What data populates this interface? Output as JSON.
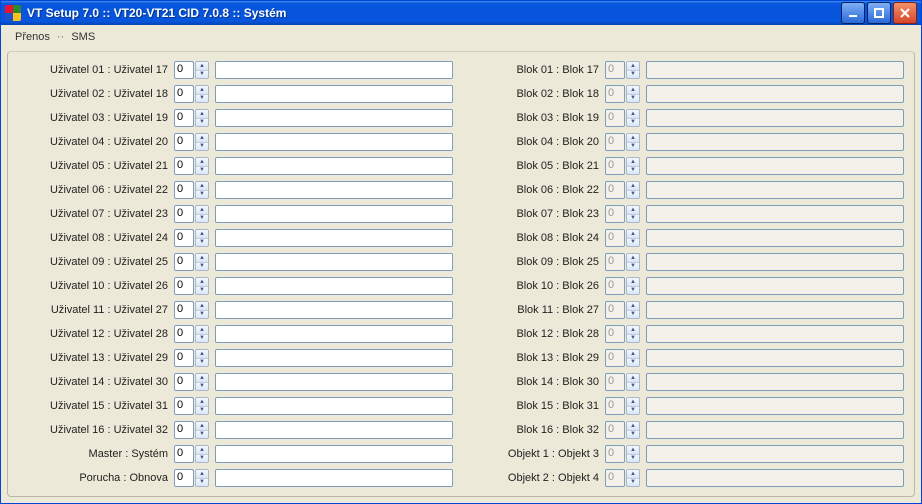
{
  "window": {
    "title": "VT Setup 7.0 :: VT20-VT21 CID 7.0.8 :: Systém"
  },
  "menubar": {
    "items": [
      "Přenos",
      "SMS"
    ],
    "separator": "··"
  },
  "columns": {
    "left": {
      "rows": [
        {
          "label": "Uživatel 01 : Uživatel 17",
          "num": "0",
          "enabled": true,
          "text": ""
        },
        {
          "label": "Uživatel 02 : Uživatel 18",
          "num": "0",
          "enabled": true,
          "text": ""
        },
        {
          "label": "Uživatel 03 : Uživatel 19",
          "num": "0",
          "enabled": true,
          "text": ""
        },
        {
          "label": "Uživatel 04 : Uživatel 20",
          "num": "0",
          "enabled": true,
          "text": ""
        },
        {
          "label": "Uživatel 05 : Uživatel 21",
          "num": "0",
          "enabled": true,
          "text": ""
        },
        {
          "label": "Uživatel 06 : Uživatel 22",
          "num": "0",
          "enabled": true,
          "text": ""
        },
        {
          "label": "Uživatel 07 : Uživatel 23",
          "num": "0",
          "enabled": true,
          "text": ""
        },
        {
          "label": "Uživatel 08 : Uživatel 24",
          "num": "0",
          "enabled": true,
          "text": ""
        },
        {
          "label": "Uživatel 09 : Uživatel 25",
          "num": "0",
          "enabled": true,
          "text": ""
        },
        {
          "label": "Uživatel 10 : Uživatel 26",
          "num": "0",
          "enabled": true,
          "text": ""
        },
        {
          "label": "Uživatel 11 : Uživatel 27",
          "num": "0",
          "enabled": true,
          "text": ""
        },
        {
          "label": "Uživatel 12 : Uživatel 28",
          "num": "0",
          "enabled": true,
          "text": ""
        },
        {
          "label": "Uživatel 13 : Uživatel 29",
          "num": "0",
          "enabled": true,
          "text": ""
        },
        {
          "label": "Uživatel 14 : Uživatel 30",
          "num": "0",
          "enabled": true,
          "text": ""
        },
        {
          "label": "Uživatel 15 : Uživatel 31",
          "num": "0",
          "enabled": true,
          "text": ""
        },
        {
          "label": "Uživatel 16 : Uživatel 32",
          "num": "0",
          "enabled": true,
          "text": ""
        },
        {
          "label": "Master : Systém",
          "num": "0",
          "enabled": true,
          "text": ""
        },
        {
          "label": "Porucha : Obnova",
          "num": "0",
          "enabled": true,
          "text": ""
        }
      ]
    },
    "right": {
      "rows": [
        {
          "label": "Blok 01 : Blok 17",
          "num": "0",
          "enabled": false,
          "text": ""
        },
        {
          "label": "Blok 02 : Blok 18",
          "num": "0",
          "enabled": false,
          "text": ""
        },
        {
          "label": "Blok 03 : Blok 19",
          "num": "0",
          "enabled": false,
          "text": ""
        },
        {
          "label": "Blok 04 : Blok 20",
          "num": "0",
          "enabled": false,
          "text": ""
        },
        {
          "label": "Blok 05 : Blok 21",
          "num": "0",
          "enabled": false,
          "text": ""
        },
        {
          "label": "Blok 06 : Blok 22",
          "num": "0",
          "enabled": false,
          "text": ""
        },
        {
          "label": "Blok 07 : Blok 23",
          "num": "0",
          "enabled": false,
          "text": ""
        },
        {
          "label": "Blok 08 : Blok 24",
          "num": "0",
          "enabled": false,
          "text": ""
        },
        {
          "label": "Blok 09 : Blok 25",
          "num": "0",
          "enabled": false,
          "text": ""
        },
        {
          "label": "Blok 10 : Blok 26",
          "num": "0",
          "enabled": false,
          "text": ""
        },
        {
          "label": "Blok 11 : Blok 27",
          "num": "0",
          "enabled": false,
          "text": ""
        },
        {
          "label": "Blok 12 : Blok 28",
          "num": "0",
          "enabled": false,
          "text": ""
        },
        {
          "label": "Blok 13 : Blok 29",
          "num": "0",
          "enabled": false,
          "text": ""
        },
        {
          "label": "Blok 14 : Blok 30",
          "num": "0",
          "enabled": false,
          "text": ""
        },
        {
          "label": "Blok 15 : Blok 31",
          "num": "0",
          "enabled": false,
          "text": ""
        },
        {
          "label": "Blok 16 : Blok 32",
          "num": "0",
          "enabled": false,
          "text": ""
        },
        {
          "label": "Objekt 1 : Objekt 3",
          "num": "0",
          "enabled": false,
          "text": ""
        },
        {
          "label": "Objekt 2 : Objekt 4",
          "num": "0",
          "enabled": false,
          "text": ""
        }
      ]
    }
  }
}
